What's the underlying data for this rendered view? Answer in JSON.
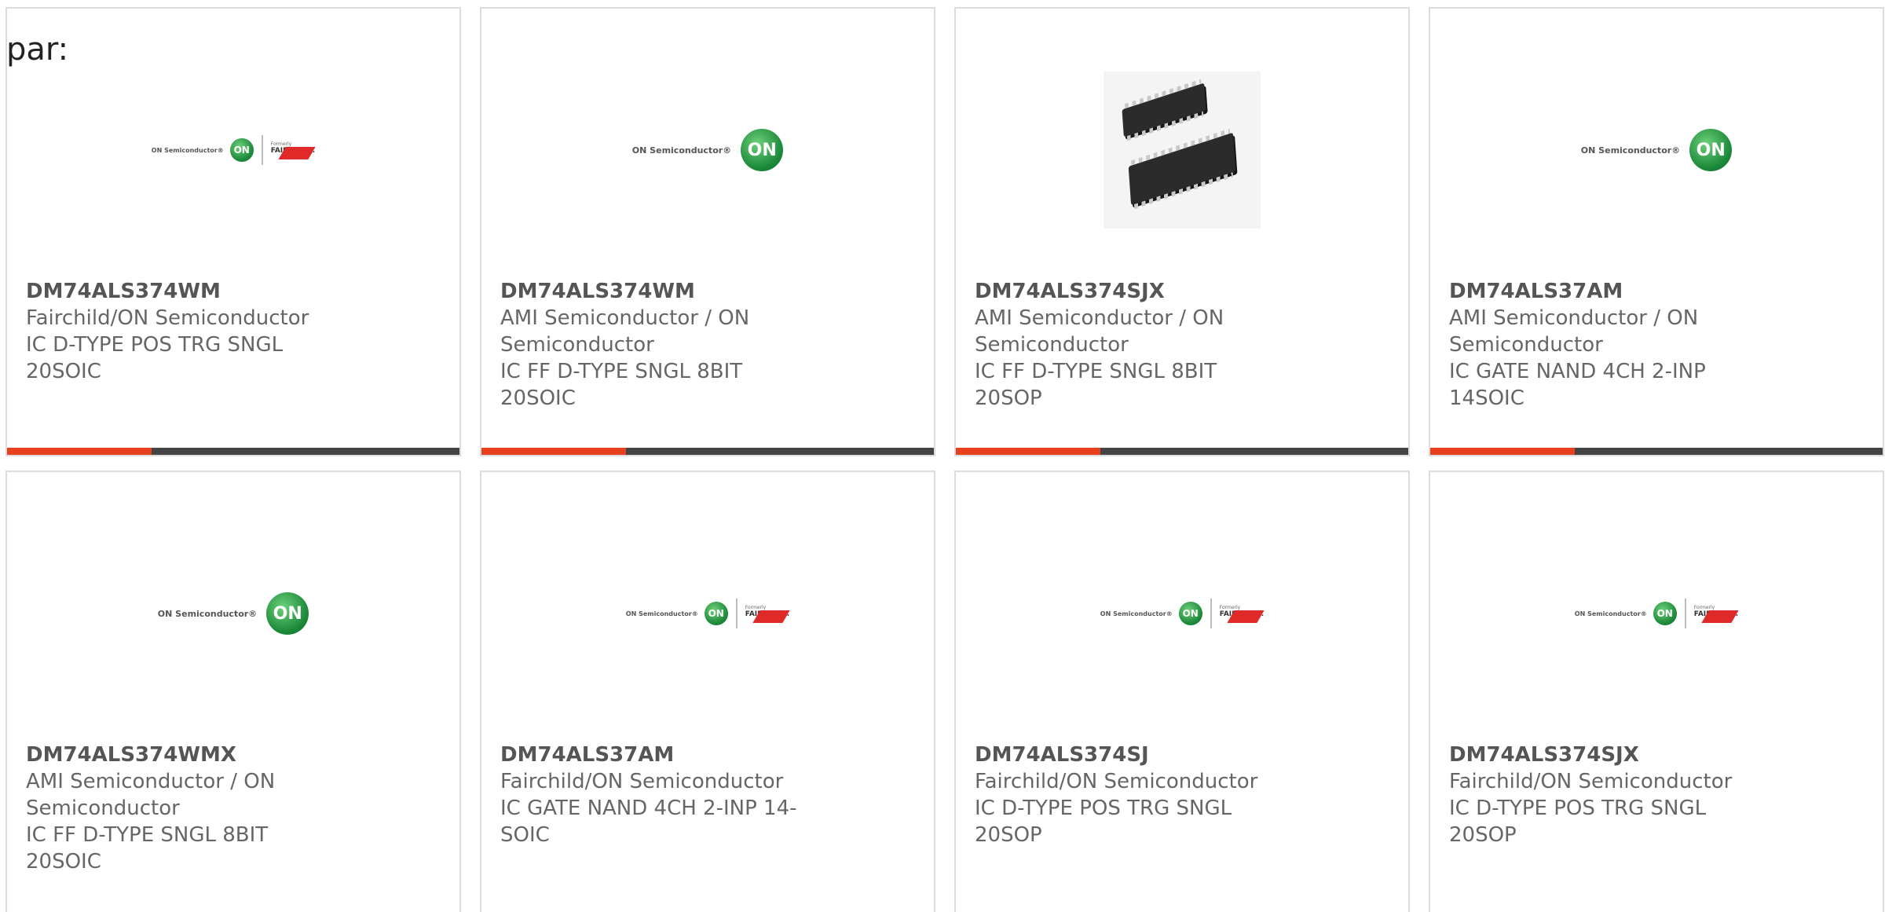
{
  "page": {
    "prefix": "par:"
  },
  "colors": {
    "accent_bar": "#e8401c",
    "dark_bar": "#444444",
    "card_border": "#dcdcdc",
    "text": "#666666"
  },
  "products": [
    {
      "part_number": "DM74ALS374WM",
      "manufacturer": "Fairchild/ON Semiconductor",
      "description": "IC D-TYPE POS TRG SNGL 20SOIC",
      "image": "on-fairchild-logo"
    },
    {
      "part_number": "DM74ALS374WM",
      "manufacturer": "AMI Semiconductor / ON Semiconductor",
      "description": "IC FF D-TYPE SNGL 8BIT 20SOIC",
      "image": "on-semiconductor-logo"
    },
    {
      "part_number": "DM74ALS374SJX",
      "manufacturer": "AMI Semiconductor / ON Semiconductor",
      "description": "IC FF D-TYPE SNGL 8BIT 20SOP",
      "image": "ic-chip-photo"
    },
    {
      "part_number": "DM74ALS37AM",
      "manufacturer": "AMI Semiconductor / ON Semiconductor",
      "description": "IC GATE NAND 4CH 2-INP 14SOIC",
      "image": "on-semiconductor-logo"
    },
    {
      "part_number": "DM74ALS374WMX",
      "manufacturer": "AMI Semiconductor / ON Semiconductor",
      "description": "IC FF D-TYPE SNGL 8BIT 20SOIC",
      "image": "on-semiconductor-logo"
    },
    {
      "part_number": "DM74ALS37AM",
      "manufacturer": "Fairchild/ON Semiconductor",
      "description": "IC GATE NAND 4CH 2-INP 14-SOIC",
      "image": "on-fairchild-logo"
    },
    {
      "part_number": "DM74ALS374SJ",
      "manufacturer": "Fairchild/ON Semiconductor",
      "description": "IC D-TYPE POS TRG SNGL 20SOP",
      "image": "on-fairchild-logo"
    },
    {
      "part_number": "DM74ALS374SJX",
      "manufacturer": "Fairchild/ON Semiconductor",
      "description": "IC D-TYPE POS TRG SNGL 20SOP",
      "image": "on-fairchild-logo"
    }
  ],
  "logos": {
    "on_text": "ON Semiconductor®",
    "on_mark": "ON",
    "formerly": "Formerly",
    "fairchild": "FAIRCHILD."
  }
}
